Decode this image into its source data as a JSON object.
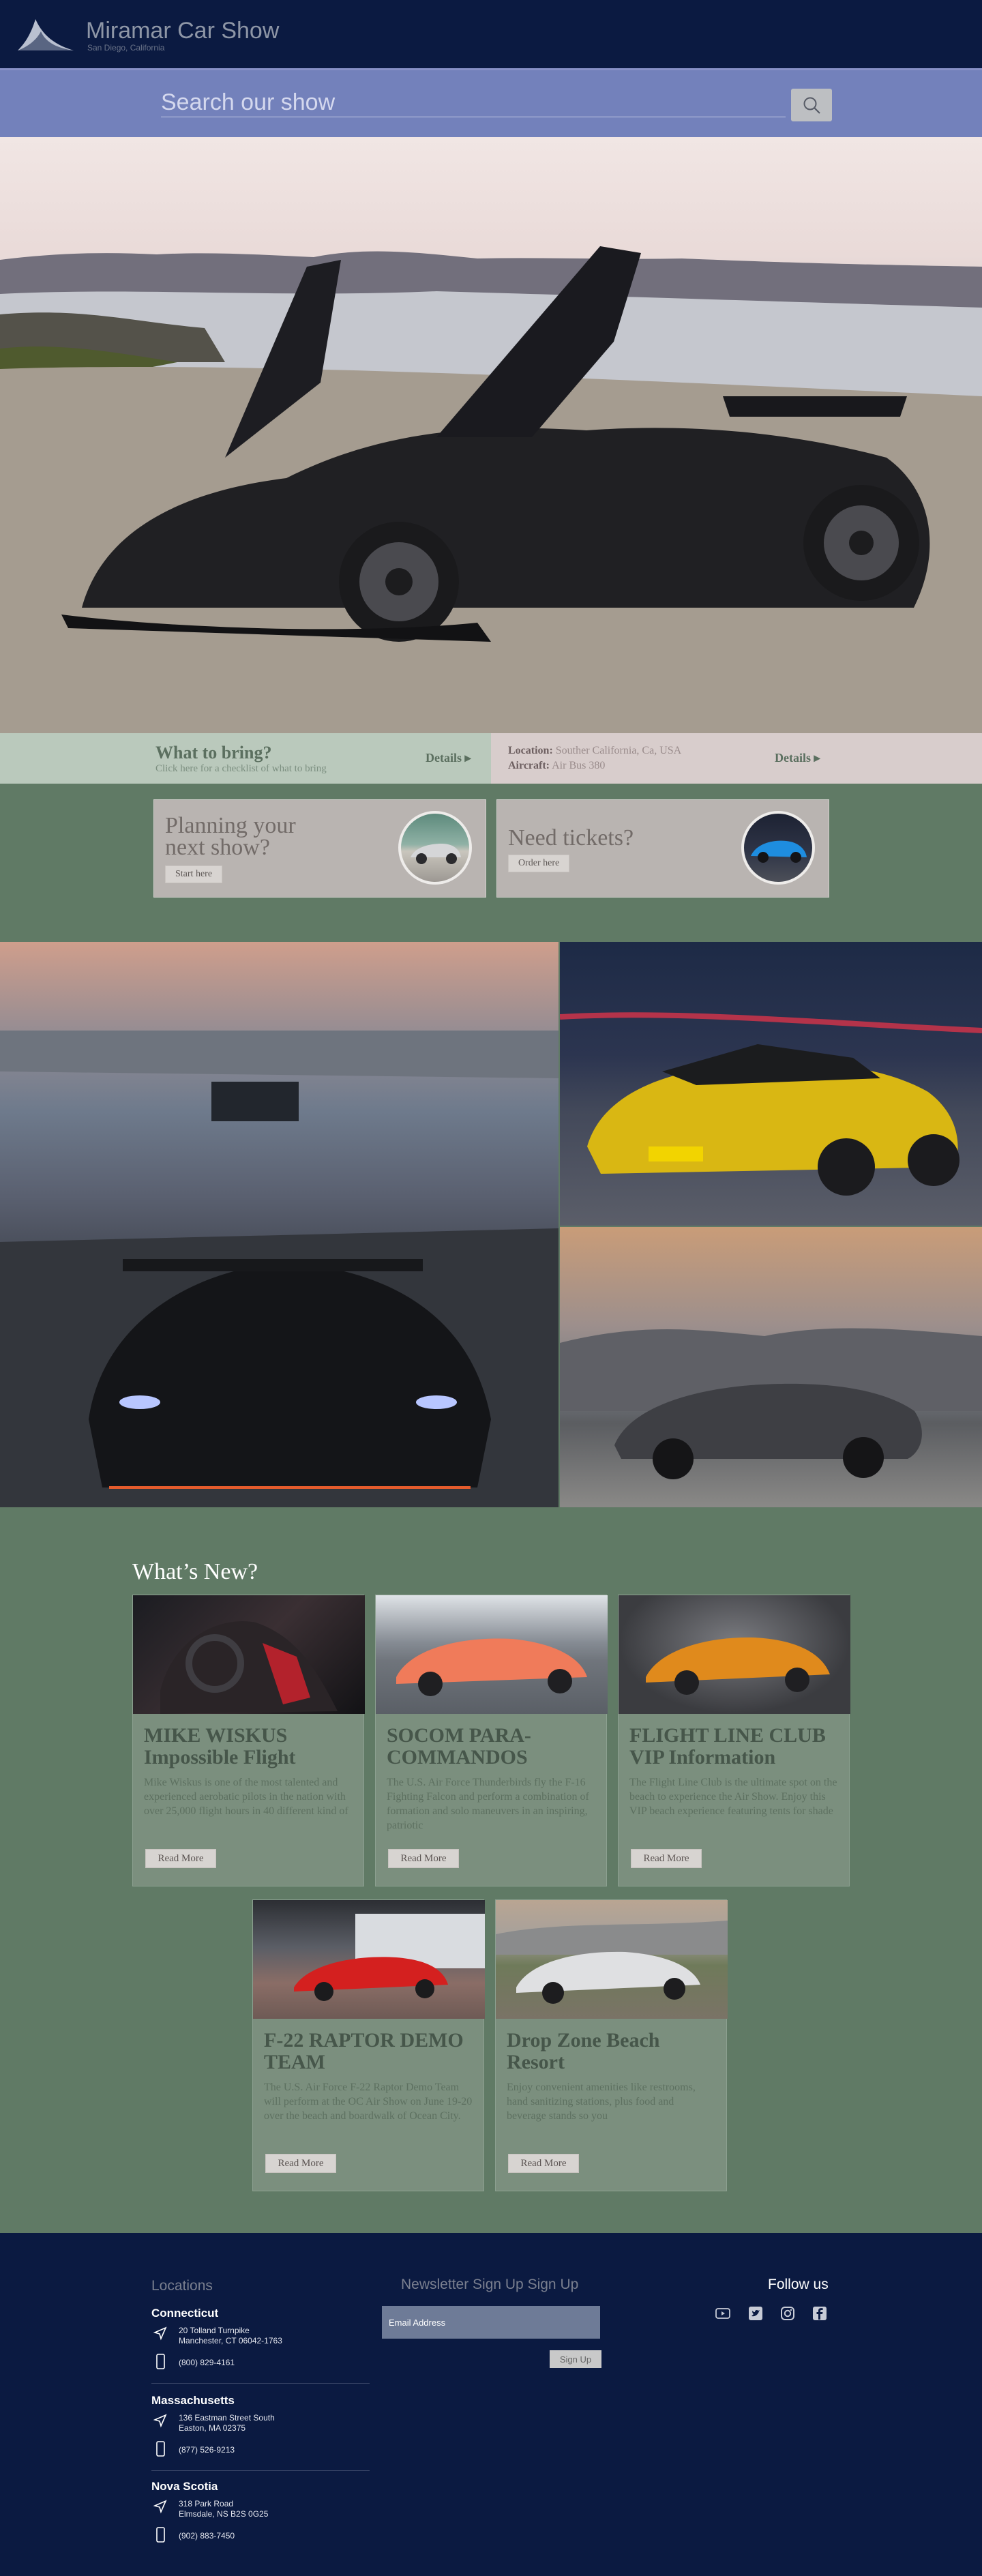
{
  "header": {
    "title": "Miramar Car Show",
    "subtitle": "San Diego, California"
  },
  "search": {
    "placeholder": "Search our show"
  },
  "infobar": {
    "bring_title": "What to bring?",
    "bring_sub": "Click here for a checklist of what to bring",
    "details_label": "Details",
    "location_label": "Location:",
    "location_value": "Souther California, Ca, USA",
    "aircraft_label": "Aircraft:",
    "aircraft_value": "Air Bus 380"
  },
  "cards": [
    {
      "title": "Planning your next show?",
      "button": "Start here"
    },
    {
      "title": "Need tickets?",
      "button": "Order here"
    }
  ],
  "whats_new": {
    "title": "What’s New?",
    "items": [
      {
        "title": "MIKE WISKUS Impossible Flight",
        "body": "Mike Wiskus is one of the most talented and experienced aerobatic pilots in the nation with over 25,000 flight hours in 40 different kind of",
        "button": "Read More"
      },
      {
        "title": "SOCOM PARA-COMMANDOS",
        "body": "The U.S. Air Force Thunderbirds fly the F-16 Fighting Falcon and perform a combination of formation and solo maneuvers in an inspiring, patriotic",
        "button": "Read More"
      },
      {
        "title": "FLIGHT LINE CLUB VIP Information",
        "body": "The Flight Line Club is the ultimate spot on the beach to experience the Air Show. Enjoy this VIP beach experience featuring tents for shade",
        "button": "Read More"
      },
      {
        "title": "F-22 RAPTOR DEMO TEAM",
        "body": "The U.S. Air Force F-22 Raptor Demo Team will perform at the OC Air Show on June 19-20 over the beach and boardwalk of Ocean City.",
        "button": "Read More"
      },
      {
        "title": "Drop Zone Beach Resort",
        "body": "Enjoy convenient amenities like restrooms, hand sanitizing stations, plus food and beverage stands so you",
        "button": "Read More"
      }
    ]
  },
  "footer": {
    "locations_title": "Locations",
    "locations": [
      {
        "name": "Connecticut",
        "address1": "20 Tolland  Turnpike",
        "address2": "Manchester, CT 06042-1763",
        "phone": "(800) 829-4161"
      },
      {
        "name": "Massachusetts",
        "address1": "136 Eastman Street South",
        "address2": "Easton,  MA 02375",
        "phone": "(877) 526-9213"
      },
      {
        "name": "Nova Scotia",
        "address1": "318 Park Road",
        "address2": "Elmsdale, NS B2S 0G25",
        "phone": "(902) 883-7450"
      }
    ],
    "newsletter_title": "Newsletter Sign Up Sign Up",
    "email_placeholder": "Email Address",
    "signup_label": "Sign Up",
    "follow_title": "Follow us",
    "social": [
      "youtube-icon",
      "twitter-icon",
      "instagram-icon",
      "facebook-icon"
    ]
  }
}
